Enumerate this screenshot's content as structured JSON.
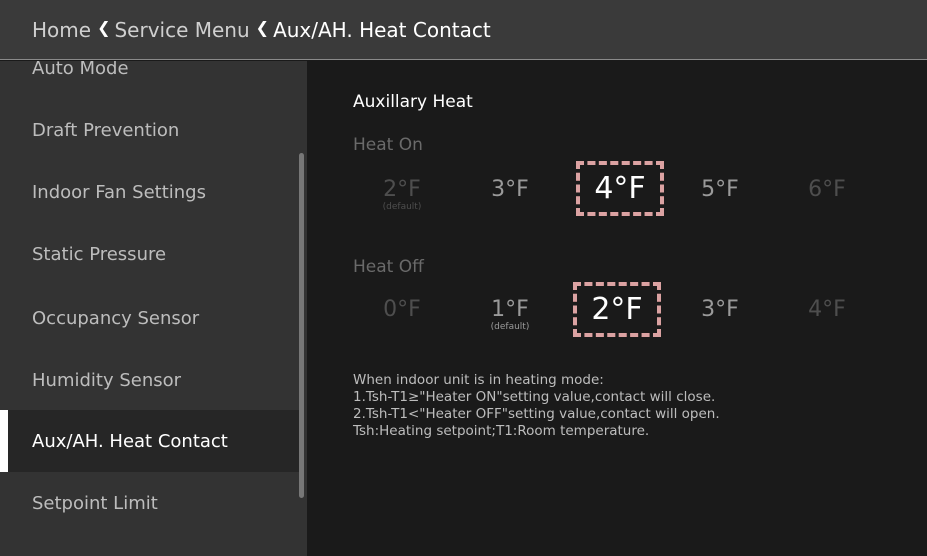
{
  "breadcrumb": {
    "home": "Home",
    "service_menu": "Service Menu",
    "current": "Aux/AH. Heat Contact"
  },
  "sidebar": {
    "items": [
      {
        "label": "Auto Mode"
      },
      {
        "label": "Draft Prevention"
      },
      {
        "label": "Indoor Fan Settings"
      },
      {
        "label": "Static Pressure"
      },
      {
        "label": "Occupancy Sensor"
      },
      {
        "label": "Humidity Sensor"
      },
      {
        "label": "Aux/AH. Heat Contact"
      },
      {
        "label": "Setpoint Limit"
      }
    ],
    "active_index": 6
  },
  "main": {
    "section_title": "Auxillary Heat",
    "heat_on": {
      "label": "Heat On",
      "options": [
        "2°F",
        "3°F",
        "4°F",
        "5°F",
        "6°F"
      ],
      "default_note": "(default)",
      "selected": "4°F"
    },
    "heat_off": {
      "label": "Heat Off",
      "options": [
        "0°F",
        "1°F",
        "2°F",
        "3°F",
        "4°F"
      ],
      "default_note": "(default)",
      "selected": "2°F"
    },
    "note_lines": [
      "When indoor unit is in heating mode:",
      "1.Tsh-T1≥\"Heater ON\"setting value,contact will close.",
      "2.Tsh-T1<\"Heater OFF\"setting value,contact will open.",
      "Tsh:Heating setpoint;T1:Room temperature."
    ]
  },
  "colors": {
    "header_bg": "#3a3a3a",
    "sidebar_bg": "#333333",
    "main_bg": "#1a1a1a",
    "selection_accent": "#b03030"
  }
}
